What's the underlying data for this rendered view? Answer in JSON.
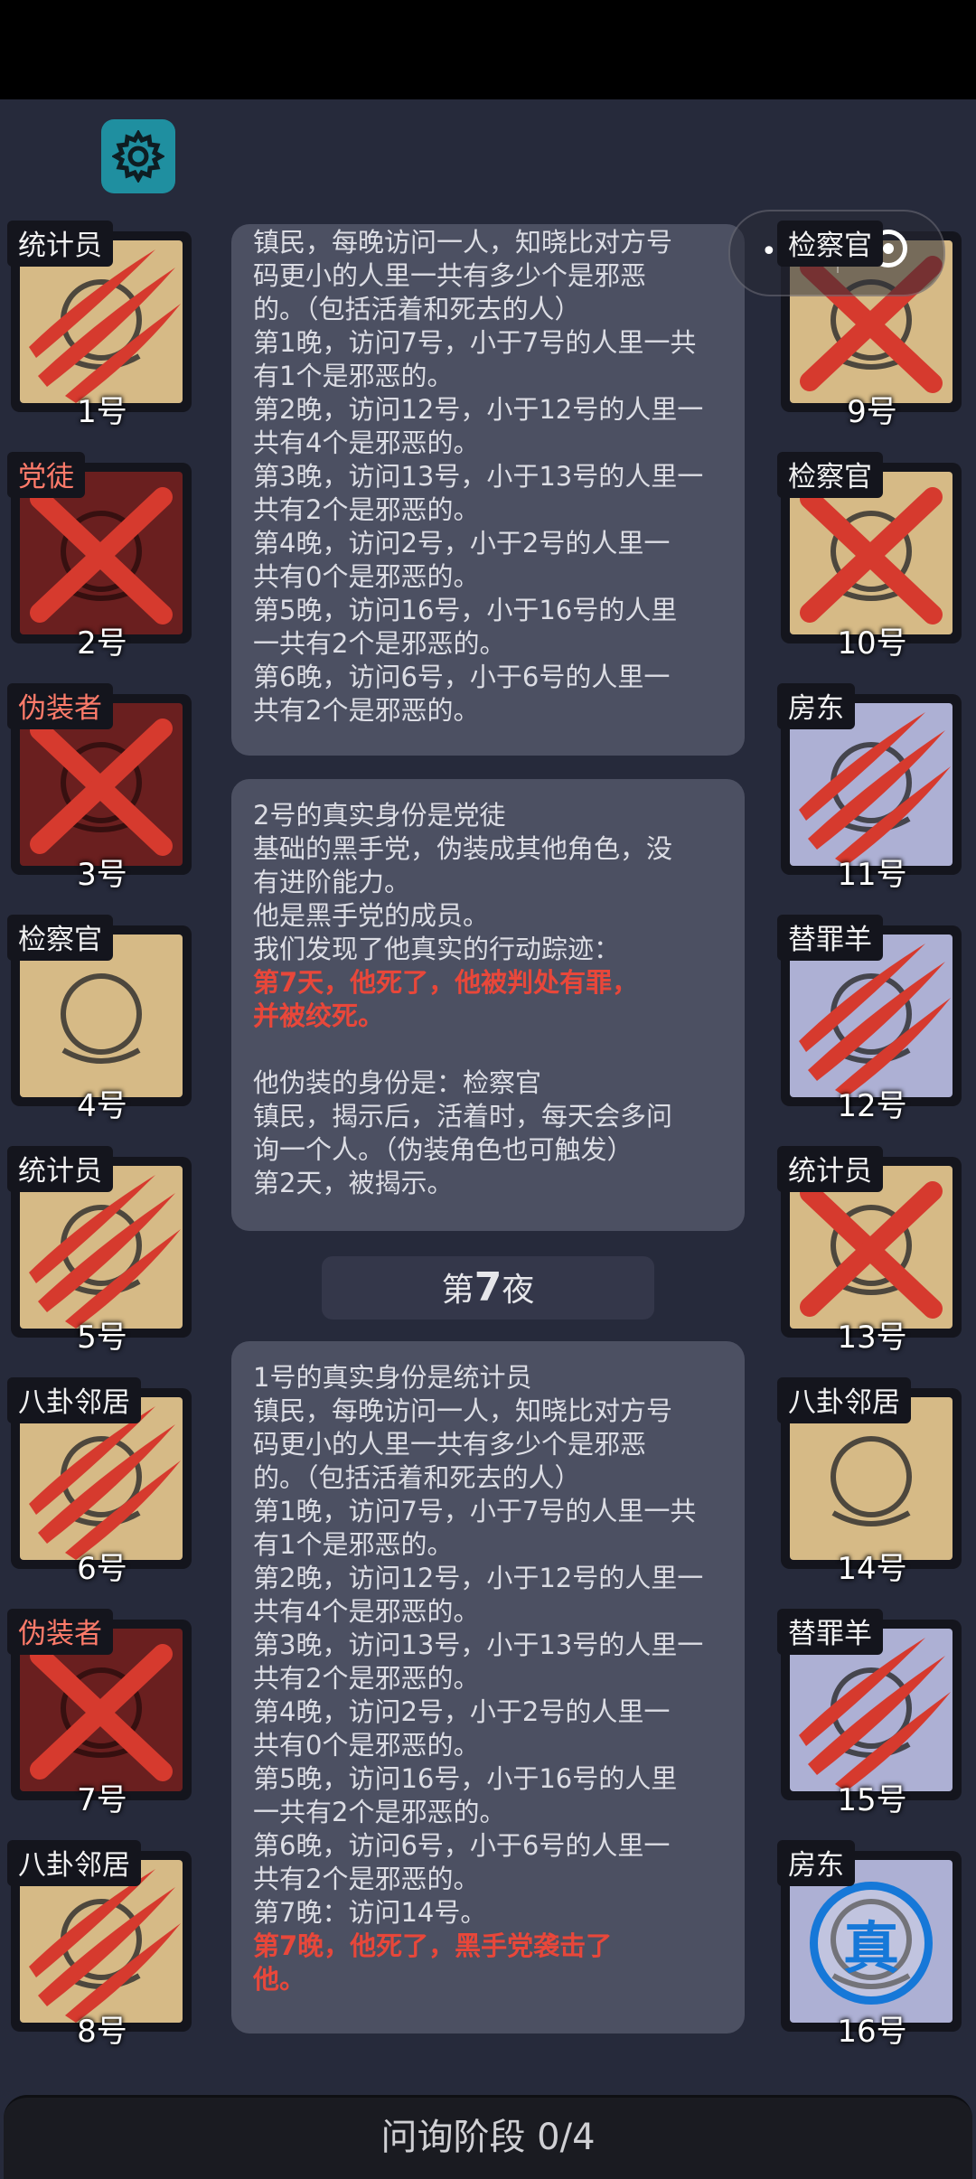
{
  "game": {
    "phase_label": "问询阶段 0/4",
    "night_prefix": "第",
    "night_number": "7",
    "night_suffix": "夜"
  },
  "top_bar": {
    "capsule_dots": "•••"
  },
  "players": {
    "p1": {
      "role": "统计员",
      "number": "1号",
      "team": "town",
      "mark": "claw"
    },
    "p2": {
      "role": "党徒",
      "number": "2号",
      "team": "evil",
      "mark": "x"
    },
    "p3": {
      "role": "伪装者",
      "number": "3号",
      "team": "evil",
      "mark": "x"
    },
    "p4": {
      "role": "检察官",
      "number": "4号",
      "team": "town",
      "mark": "none"
    },
    "p5": {
      "role": "统计员",
      "number": "5号",
      "team": "town",
      "mark": "claw"
    },
    "p6": {
      "role": "八卦邻居",
      "number": "6号",
      "team": "town",
      "mark": "claw"
    },
    "p7": {
      "role": "伪装者",
      "number": "7号",
      "team": "evil",
      "mark": "x"
    },
    "p8": {
      "role": "八卦邻居",
      "number": "8号",
      "team": "town",
      "mark": "claw"
    },
    "p9": {
      "role": "检察官",
      "number": "9号",
      "team": "town",
      "mark": "x"
    },
    "p10": {
      "role": "检察官",
      "number": "10号",
      "team": "town",
      "mark": "x"
    },
    "p11": {
      "role": "房东",
      "number": "11号",
      "team": "outsider",
      "mark": "claw"
    },
    "p12": {
      "role": "替罪羊",
      "number": "12号",
      "team": "outsider",
      "mark": "claw"
    },
    "p13": {
      "role": "统计员",
      "number": "13号",
      "team": "town",
      "mark": "x"
    },
    "p14": {
      "role": "八卦邻居",
      "number": "14号",
      "team": "town",
      "mark": "none"
    },
    "p15": {
      "role": "替罪羊",
      "number": "15号",
      "team": "outsider",
      "mark": "claw"
    },
    "p16": {
      "role": "房东",
      "number": "16号",
      "team": "outsider",
      "mark": "verified"
    }
  },
  "verified_badge": "真",
  "log_panel_1": {
    "lines": [
      "镇民，每晚访问一人，知晓比对方号",
      "码更小的人里一共有多少个是邪恶",
      "的。（包括活着和死去的人）",
      "第1晚，访问7号，小于7号的人里一共",
      "有1个是邪恶的。",
      "第2晚，访问12号，小于12号的人里一",
      "共有4个是邪恶的。",
      "第3晚，访问13号，小于13号的人里一",
      "共有2个是邪恶的。",
      "第4晚，访问2号，小于2号的人里一",
      "共有0个是邪恶的。",
      "第5晚，访问16号，小于16号的人里",
      "一共有2个是邪恶的。",
      "第6晚，访问6号，小于6号的人里一",
      "共有2个是邪恶的。"
    ]
  },
  "log_panel_2": {
    "lines": [
      "2号的真实身份是党徒",
      "基础的黑手党，伪装成其他角色，没",
      "有进阶能力。",
      "他是黑手党的成员。",
      "我们发现了他真实的行动踪迹："
    ],
    "red_lines": [
      "第7天，他死了，他被判处有罪，",
      "并被绞死。"
    ],
    "lines_after": [
      "他伪装的身份是：检察官",
      "镇民，揭示后，活着时，每天会多问",
      "询一个人。（伪装角色也可触发）",
      "第2天，被揭示。"
    ]
  },
  "log_panel_3": {
    "lines": [
      "1号的真实身份是统计员",
      "镇民，每晚访问一人，知晓比对方号",
      "码更小的人里一共有多少个是邪恶",
      "的。（包括活着和死去的人）",
      "第1晚，访问7号，小于7号的人里一共",
      "有1个是邪恶的。",
      "第2晚，访问12号，小于12号的人里一",
      "共有4个是邪恶的。",
      "第3晚，访问13号，小于13号的人里一",
      "共有2个是邪恶的。",
      "第4晚，访问2号，小于2号的人里一",
      "共有0个是邪恶的。",
      "第5晚，访问16号，小于16号的人里",
      "一共有2个是邪恶的。",
      "第6晚，访问6号，小于6号的人里一",
      "共有2个是邪恶的。",
      "第7晚：访问14号。"
    ],
    "red_lines": [
      "第7晚，他死了，黑手党袭击了",
      "他。"
    ]
  },
  "colors": {
    "background": "#262a3b",
    "panel": "#4c5062",
    "town_card": "#d6ba86",
    "evil_card": "#6a1f1f",
    "outsider_card": "#adb0d4",
    "death_mark": "#d63a2e",
    "highlight_red": "#e8473a",
    "settings_button": "#1f8fa0",
    "verify_blue": "#1678d8"
  }
}
